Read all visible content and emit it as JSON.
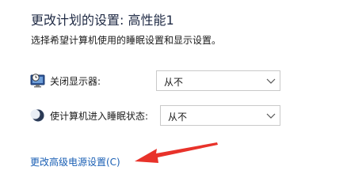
{
  "header": {
    "title": "更改计划的设置: 高性能1",
    "subtitle": "选择希望计算机使用的睡眠设置和显示设置。"
  },
  "settings": [
    {
      "label": "关闭显示器:",
      "value": "从不",
      "icon": "monitor-clock-icon"
    },
    {
      "label": "使计算机进入睡眠状态:",
      "value": "从不",
      "icon": "moon-icon"
    }
  ],
  "advanced_link": "更改高级电源设置(C)",
  "annotation": {
    "icon": "red-arrow-icon",
    "color": "#e8322a"
  },
  "colors": {
    "link": "#1a5fb4",
    "title": "#1f2a44"
  }
}
